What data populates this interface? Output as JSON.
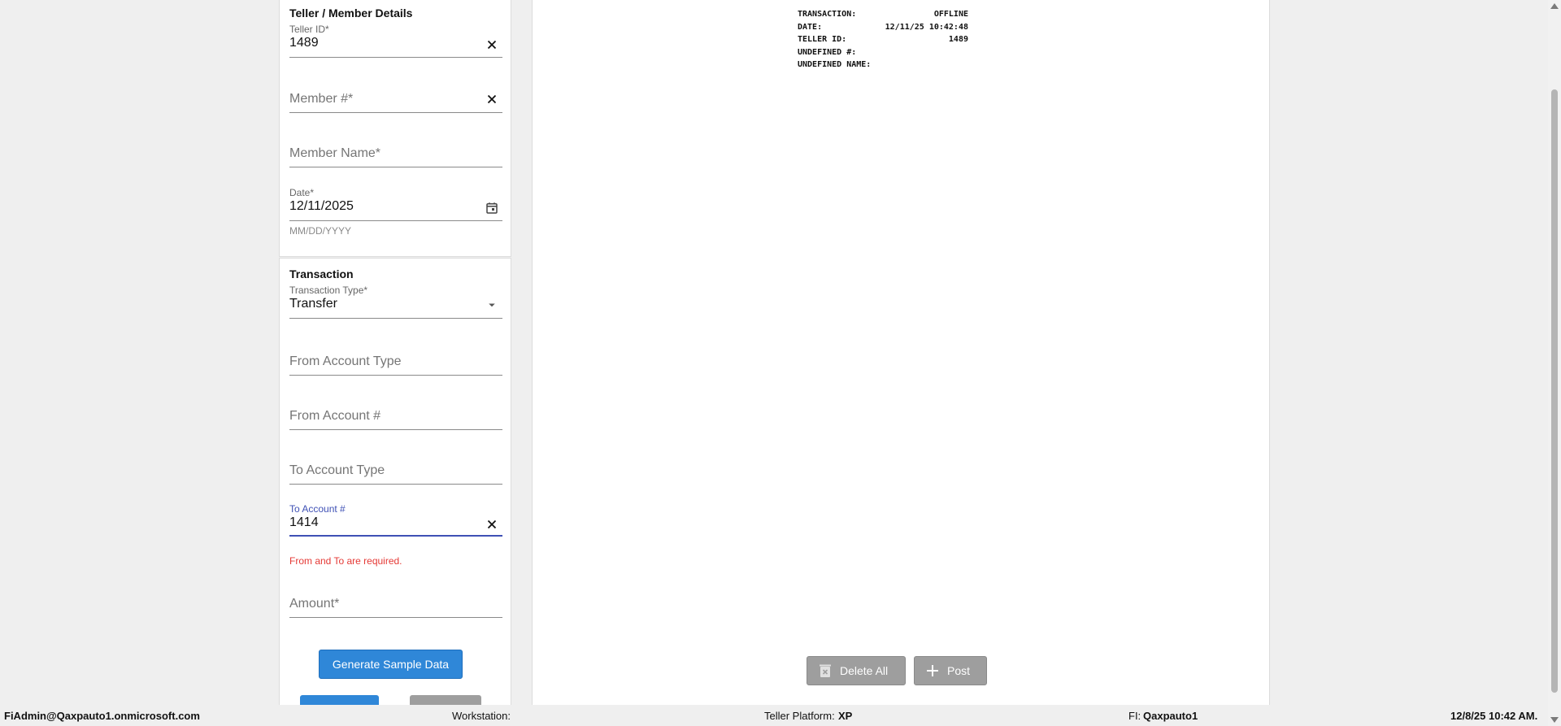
{
  "teller_member": {
    "title": "Teller / Member Details",
    "teller_id": {
      "label": "Teller ID*",
      "value": "1489"
    },
    "member_number": {
      "placeholder": "Member #*"
    },
    "member_name": {
      "placeholder": "Member Name*"
    },
    "date": {
      "label": "Date*",
      "value": "12/11/2025",
      "hint": "MM/DD/YYYY"
    }
  },
  "transaction": {
    "title": "Transaction",
    "type": {
      "label": "Transaction Type*",
      "value": "Transfer"
    },
    "from_account_type": {
      "placeholder": "From Account Type"
    },
    "from_account_number": {
      "placeholder": "From Account #"
    },
    "to_account_type": {
      "placeholder": "To Account Type"
    },
    "to_account_number": {
      "label": "To Account #",
      "value": "1414",
      "error": "From and To are required."
    },
    "amount": {
      "placeholder": "Amount*"
    },
    "generate_button": "Generate Sample Data"
  },
  "receipt": {
    "rows": [
      {
        "label": "TRANSACTION:",
        "value": "OFFLINE"
      },
      {
        "label": "DATE:",
        "value": "12/11/25 10:42:48"
      },
      {
        "label": "TELLER ID:",
        "value": "1489"
      },
      {
        "label": "UNDEFINED #:",
        "value": ""
      },
      {
        "label": "UNDEFINED NAME:",
        "value": ""
      }
    ]
  },
  "actions": {
    "delete_all": "Delete All",
    "post": "Post"
  },
  "status": {
    "user": "FiAdmin@Qaxpauto1.onmicrosoft.com",
    "workstation_label": "Workstation:",
    "platform_label": "Teller Platform:",
    "platform_value": "XP",
    "fi_label": "FI:",
    "fi_value": "Qaxpauto1",
    "datetime": "12/8/25 10:42 AM."
  },
  "colors": {
    "primary": "#2f87d8",
    "focus": "#3f51b5",
    "error": "#e53935",
    "disabled_button": "#9e9e9e"
  }
}
